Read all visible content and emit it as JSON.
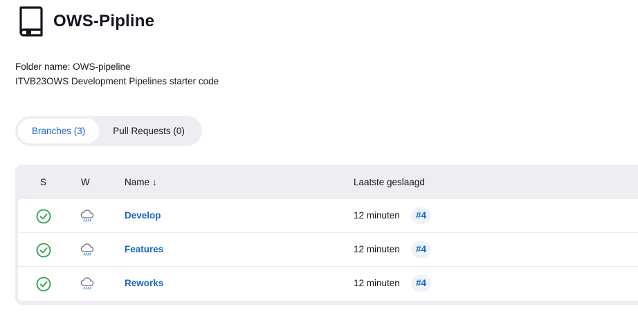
{
  "header": {
    "title": "OWS-Pipline",
    "icon": "folder-book-icon"
  },
  "description": {
    "folder_name": "Folder name: OWS-pipeline",
    "text": "ITVB23OWS Development Pipelines starter code"
  },
  "tabs": [
    {
      "label": "Branches (3)",
      "active": true
    },
    {
      "label": "Pull Requests (0)",
      "active": false
    }
  ],
  "table": {
    "columns": {
      "s": "S",
      "w": "W",
      "name": "Name",
      "sort_indicator": "↓",
      "last_success": "Laatste geslaagd"
    },
    "rows": [
      {
        "status_icon": "success-check-icon",
        "weather_icon": "rain-cloud-icon",
        "name": "Develop",
        "last_success": "12 minuten",
        "build": "#4"
      },
      {
        "status_icon": "success-check-icon",
        "weather_icon": "rain-cloud-icon",
        "name": "Features",
        "last_success": "12 minuten",
        "build": "#4"
      },
      {
        "status_icon": "success-check-icon",
        "weather_icon": "rain-cloud-icon",
        "name": "Reworks",
        "last_success": "12 minuten",
        "build": "#4"
      }
    ]
  },
  "colors": {
    "link": "#1565c9",
    "success": "#2e9e4c",
    "panel": "#eeeef2"
  }
}
